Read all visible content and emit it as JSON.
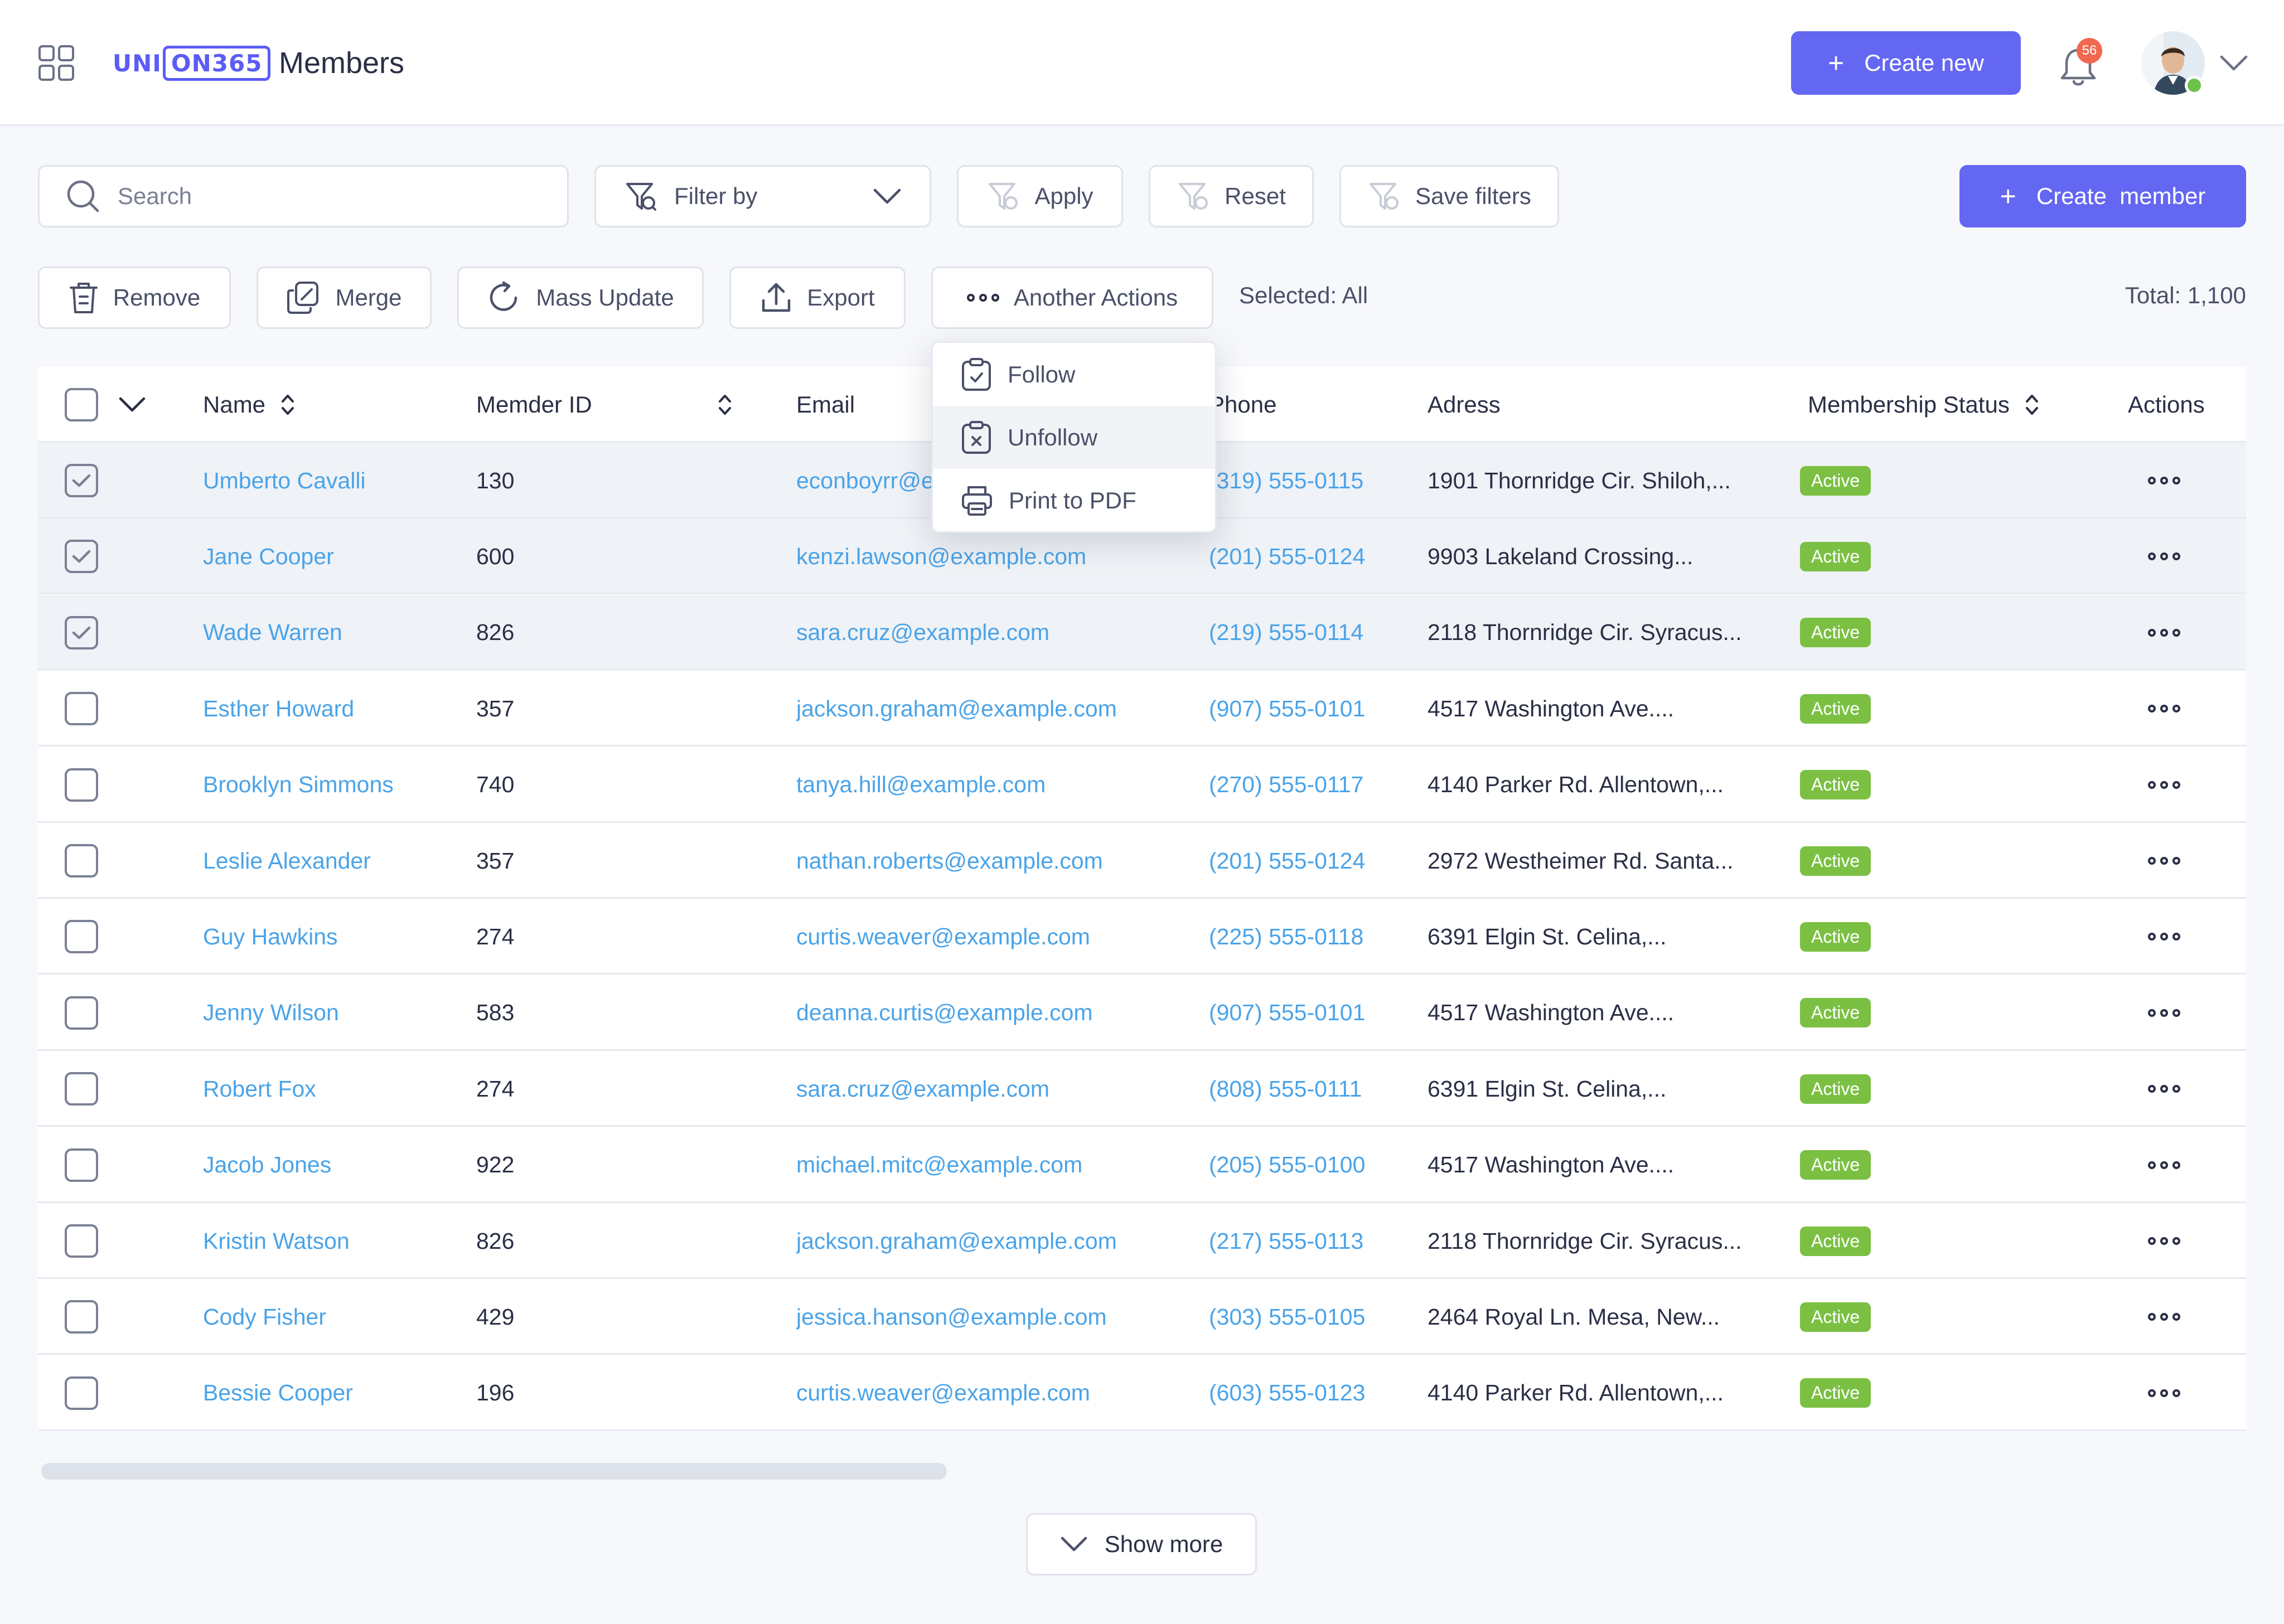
{
  "app": {
    "logo_prefix": "UNI",
    "logo_boxed": "ON365",
    "page_title": "Members"
  },
  "header": {
    "create_new_label": "Create new",
    "notification_count": "56"
  },
  "toolbar": {
    "search_placeholder": "Search",
    "filter_label": "Filter by",
    "apply_label": "Apply",
    "reset_label": "Reset",
    "save_filters_label": "Save filters",
    "create_member_label": "Create  member",
    "remove_label": "Remove",
    "merge_label": "Merge",
    "mass_update_label": "Mass Update",
    "export_label": "Export",
    "another_actions_label": "Another Actions",
    "selected_text": "Selected: All",
    "total_text": "Total: 1,100"
  },
  "actions_menu": {
    "items": [
      "Follow",
      "Unfollow",
      "Print to PDF"
    ]
  },
  "table": {
    "columns": {
      "name": "Name",
      "member_id": "Memder ID",
      "email": "Email",
      "phone": "Phone",
      "address": "Adress",
      "status": "Membership Status",
      "actions": "Actions"
    },
    "rows": [
      {
        "selected": true,
        "name": "Umberto Cavalli",
        "member_id": "130",
        "email": "econboyrr@example.com",
        "phone": "(319) 555-0115",
        "address": "1901 Thornridge Cir. Shiloh,...",
        "status": "Active"
      },
      {
        "selected": true,
        "name": "Jane Cooper",
        "member_id": "600",
        "email": "kenzi.lawson@example.com",
        "phone": "(201) 555-0124",
        "address": "9903 Lakeland Crossing...",
        "status": "Active"
      },
      {
        "selected": true,
        "name": "Wade Warren",
        "member_id": "826",
        "email": "sara.cruz@example.com",
        "phone": "(219) 555-0114",
        "address": "2118 Thornridge Cir. Syracus...",
        "status": "Active"
      },
      {
        "selected": false,
        "name": "Esther Howard",
        "member_id": "357",
        "email": "jackson.graham@example.com",
        "phone": "(907) 555-0101",
        "address": "4517 Washington Ave....",
        "status": "Active"
      },
      {
        "selected": false,
        "name": "Brooklyn Simmons",
        "member_id": "740",
        "email": "tanya.hill@example.com",
        "phone": "(270) 555-0117",
        "address": "4140 Parker Rd. Allentown,...",
        "status": "Active"
      },
      {
        "selected": false,
        "name": "Leslie Alexander",
        "member_id": "357",
        "email": "nathan.roberts@example.com",
        "phone": "(201) 555-0124",
        "address": "2972 Westheimer Rd. Santa...",
        "status": "Active"
      },
      {
        "selected": false,
        "name": "Guy Hawkins",
        "member_id": "274",
        "email": "curtis.weaver@example.com",
        "phone": "(225) 555-0118",
        "address": "6391 Elgin St. Celina,...",
        "status": "Active"
      },
      {
        "selected": false,
        "name": "Jenny Wilson",
        "member_id": "583",
        "email": "deanna.curtis@example.com",
        "phone": "(907) 555-0101",
        "address": "4517 Washington Ave....",
        "status": "Active"
      },
      {
        "selected": false,
        "name": "Robert Fox",
        "member_id": "274",
        "email": "sara.cruz@example.com",
        "phone": "(808) 555-0111",
        "address": "6391 Elgin St. Celina,...",
        "status": "Active"
      },
      {
        "selected": false,
        "name": "Jacob Jones",
        "member_id": "922",
        "email": "michael.mitc@example.com",
        "phone": "(205) 555-0100",
        "address": "4517 Washington Ave....",
        "status": "Active"
      },
      {
        "selected": false,
        "name": "Kristin Watson",
        "member_id": "826",
        "email": "jackson.graham@example.com",
        "phone": "(217) 555-0113",
        "address": "2118 Thornridge Cir. Syracus...",
        "status": "Active"
      },
      {
        "selected": false,
        "name": "Cody Fisher",
        "member_id": "429",
        "email": "jessica.hanson@example.com",
        "phone": "(303) 555-0105",
        "address": "2464 Royal Ln. Mesa, New...",
        "status": "Active"
      },
      {
        "selected": false,
        "name": "Bessie Cooper",
        "member_id": "196",
        "email": "curtis.weaver@example.com",
        "phone": "(603) 555-0123",
        "address": "4140 Parker Rd. Allentown,...",
        "status": "Active"
      }
    ]
  },
  "footer": {
    "show_more_label": "Show more"
  },
  "colors": {
    "primary": "#6467f2",
    "link": "#4aa3e8",
    "status_active": "#7bc043",
    "badge": "#f0684f"
  },
  "icons": [
    "grid-icon",
    "plus-icon",
    "bell-icon",
    "chevron-down-icon",
    "search-icon",
    "filter-icon",
    "trash-icon",
    "merge-icon",
    "refresh-icon",
    "upload-icon",
    "more-icon",
    "sort-icon",
    "checkbox-icon",
    "clipboard-check-icon",
    "clipboard-x-icon",
    "printer-icon"
  ]
}
